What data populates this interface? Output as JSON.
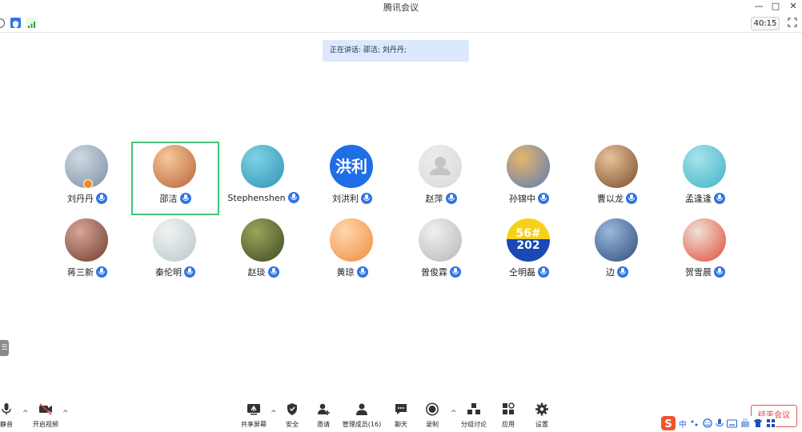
{
  "window": {
    "title": "腾讯会议",
    "controls": [
      "—",
      "□",
      "✕"
    ]
  },
  "infobar": {
    "timer": "40:15"
  },
  "speaking": "正在讲话: 邵洁; 刘丹丹;",
  "participants": [
    {
      "name": "刘丹丹",
      "avatar_text": "",
      "avatar_colors": [
        "#cfd9e3",
        "#7a8fa3"
      ]
    },
    {
      "name": "邵洁",
      "avatar_text": "",
      "avatar_colors": [
        "#f5c79a",
        "#b8653a"
      ]
    },
    {
      "name": "Stephenshen",
      "avatar_text": "",
      "avatar_colors": [
        "#7fd3e6",
        "#2e93b4"
      ]
    },
    {
      "name": "刘洪利",
      "avatar_text": "洪利",
      "avatar_colors": [
        "#1e6ee8",
        "#1e6ee8"
      ]
    },
    {
      "name": "赵萍",
      "avatar_text": "",
      "avatar_colors": [
        "#ececec",
        "#d9d9d9"
      ]
    },
    {
      "name": "孙锦中",
      "avatar_text": "",
      "avatar_colors": [
        "#e7b66a",
        "#5a7bb8"
      ]
    },
    {
      "name": "曹以龙",
      "avatar_text": "",
      "avatar_colors": [
        "#e6c49a",
        "#7a4a2b"
      ]
    },
    {
      "name": "孟逢逢",
      "avatar_text": "",
      "avatar_colors": [
        "#a9e3ec",
        "#3fb3c8"
      ]
    },
    {
      "name": "蒋三新",
      "avatar_text": "",
      "avatar_colors": [
        "#d8a79a",
        "#6f3b2c"
      ]
    },
    {
      "name": "秦伦明",
      "avatar_text": "",
      "avatar_colors": [
        "#f1f3f3",
        "#b9c7cc"
      ]
    },
    {
      "name": "赵琰",
      "avatar_text": "",
      "avatar_colors": [
        "#9aa65a",
        "#3e4a22"
      ]
    },
    {
      "name": "黄琼",
      "avatar_text": "",
      "avatar_colors": [
        "#ffd7b0",
        "#f08c3a"
      ]
    },
    {
      "name": "曾俊霖",
      "avatar_text": "",
      "avatar_colors": [
        "#f0f0f0",
        "#b7b7b7"
      ]
    },
    {
      "name": "仝明磊",
      "avatar_text": "56#\n202",
      "avatar_colors": [
        "#f5d21a",
        "#1a48b6"
      ]
    },
    {
      "name": "边",
      "avatar_text": "",
      "avatar_colors": [
        "#9bb8da",
        "#2d4d7c"
      ]
    },
    {
      "name": "贺雪晨",
      "avatar_text": "",
      "avatar_colors": [
        "#f1e1d6",
        "#e04c3a"
      ]
    }
  ],
  "toolbar": {
    "mute": "静音",
    "video": "开启视频",
    "share": "共享屏幕",
    "security": "安全",
    "invite": "邀请",
    "members": "管理成员(16)",
    "chat": "聊天",
    "record": "录制",
    "breakout": "分组讨论",
    "apps": "应用",
    "settings": "设置",
    "end": "结束会议"
  },
  "ime": {
    "lang": "中"
  },
  "colors": {
    "accent": "#2f74e6",
    "active_border": "#45c47a",
    "end": "#e34848"
  }
}
